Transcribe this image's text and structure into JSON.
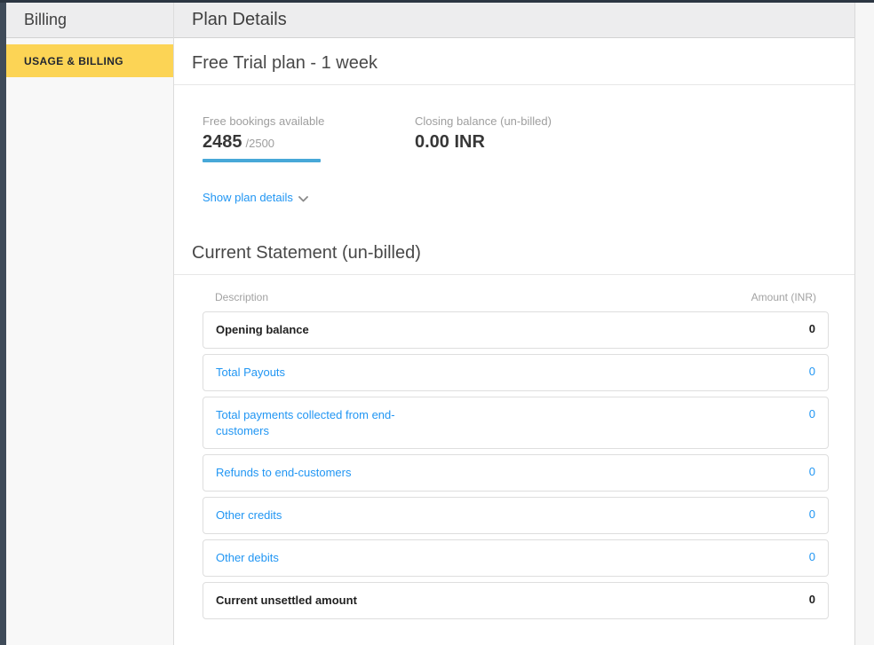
{
  "colors": {
    "accent_yellow": "#fcd455",
    "link_blue": "#2196f3",
    "progress_blue": "#47a8d8",
    "side_rail_dark": "#3f4b59",
    "top_rail_dark": "#2c3642"
  },
  "sidebar": {
    "title": "Billing",
    "items": [
      {
        "label": "USAGE & BILLING",
        "active": true
      }
    ]
  },
  "header": {
    "title": "Plan Details"
  },
  "plan": {
    "heading": "Free Trial plan - 1 week",
    "stats": [
      {
        "label": "Free bookings available",
        "value": "2485",
        "suffix": "/2500",
        "progress_pct": 100
      },
      {
        "label": "Closing balance (un-billed)",
        "value": "0.00 INR"
      }
    ],
    "show_details_label": "Show plan details"
  },
  "statement": {
    "heading": "Current Statement (un-billed)",
    "columns": {
      "description": "Description",
      "amount": "Amount (INR)"
    },
    "rows": [
      {
        "label": "Opening balance",
        "amount": "0",
        "style": "strong"
      },
      {
        "label": "Total Payouts",
        "amount": "0",
        "style": "link"
      },
      {
        "label": "Total payments collected from end-customers",
        "amount": "0",
        "style": "link"
      },
      {
        "label": "Refunds to end-customers",
        "amount": "0",
        "style": "link"
      },
      {
        "label": "Other credits",
        "amount": "0",
        "style": "link"
      },
      {
        "label": "Other debits",
        "amount": "0",
        "style": "link"
      },
      {
        "label": "Current unsettled amount",
        "amount": "0",
        "style": "strong"
      }
    ]
  }
}
